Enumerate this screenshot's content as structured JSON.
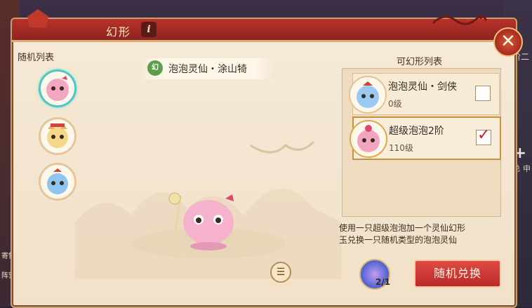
{
  "background": {
    "left_labels": [
      "寄售",
      "阵营"
    ],
    "right_label": "阶二",
    "right_label2": "总 申",
    "plus_icon": "plus-icon"
  },
  "window": {
    "title": "幻形",
    "info_label": "i",
    "close_icon": "close-icon"
  },
  "random_list": {
    "title": "随机列表",
    "pets": [
      {
        "name": "pink-bubble-pet",
        "selected": true
      },
      {
        "name": "yellow-cat-pet",
        "selected": false
      },
      {
        "name": "blue-bubble-pet",
        "selected": false
      }
    ]
  },
  "preview": {
    "icon_text": "幻",
    "pet_name": "泡泡灵仙・涂山犄",
    "detail_icon": "list-icon"
  },
  "transform_list": {
    "title": "可幻形列表",
    "items": [
      {
        "name": "泡泡灵仙・剑侠",
        "level": "0级",
        "checked": false
      },
      {
        "name": "超级泡泡2阶",
        "level": "110级",
        "checked": true
      }
    ]
  },
  "description": {
    "line1": "使用一只超级泡泡加一个灵仙幻形",
    "line2": "玉兑换一只随机类型的泡泡灵仙"
  },
  "material": {
    "icon": "jade-orb-icon",
    "count": "2/1"
  },
  "exchange_button": {
    "label": "随机兑换"
  },
  "colors": {
    "accent": "#b8322a",
    "panel": "#f6ead7",
    "selected_border": "#4fc6c4",
    "check": "#c0262a"
  }
}
